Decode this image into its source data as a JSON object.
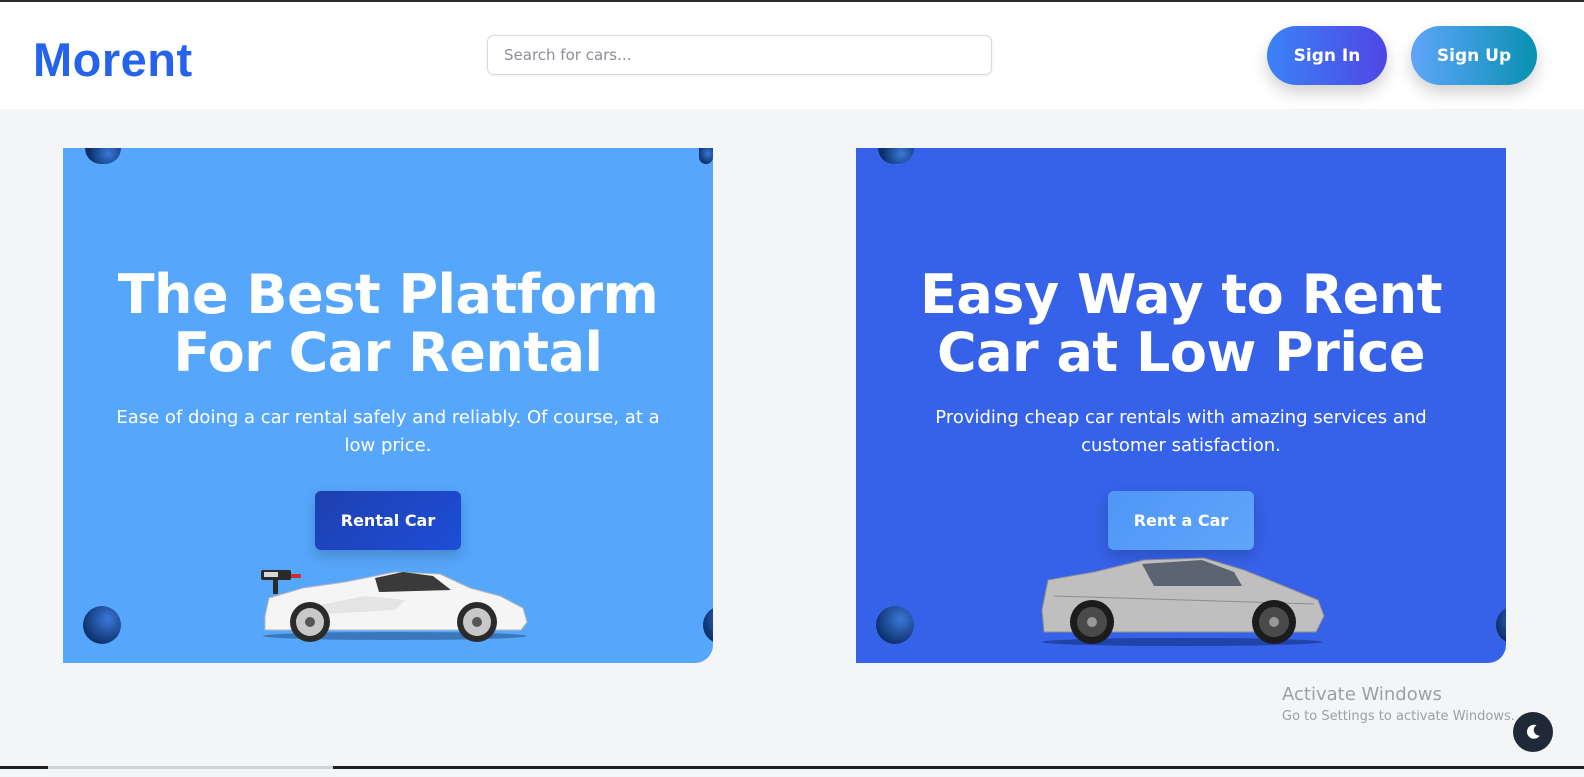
{
  "header": {
    "logo": "Morent",
    "search_placeholder": "Search for cars...",
    "signin_label": "Sign In",
    "signup_label": "Sign Up"
  },
  "cards": [
    {
      "title_line1": "The Best Platform",
      "title_line2": "For Car Rental",
      "description": "Ease of doing a car rental safely and reliably. Of course, at a low price.",
      "button_label": "Rental Car",
      "background": "#56a6fb"
    },
    {
      "title_line1": "Easy Way to Rent",
      "title_line2": "Car at Low Price",
      "description": "Providing cheap car rentals with amazing services and customer satisfaction.",
      "button_label": "Rent a Car",
      "background": "#3662e9"
    }
  ],
  "watermark": {
    "line1": "Activate Windows",
    "line2": "Go to Settings to activate Windows."
  },
  "icons": {
    "theme_toggle": "moon-icon"
  },
  "colors": {
    "brand": "#2563eb",
    "page_bg": "#f4f5f7"
  }
}
